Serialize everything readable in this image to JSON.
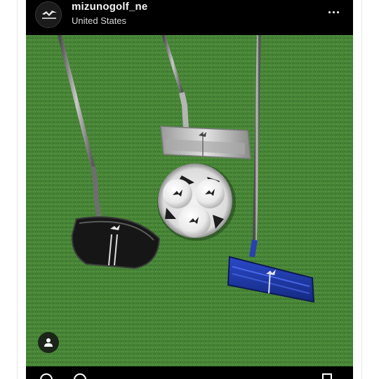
{
  "post": {
    "username": "mizunogolf_ne",
    "location": "United States",
    "avatar_icon": "mizuno-runbird-logo",
    "more_icon": "more-horizontal-icon",
    "tag_icon": "person-tag-icon"
  },
  "image": {
    "description_icon": "putters-and-golf-balls-photo"
  },
  "colors": {
    "header_bg": "#000000",
    "turf": "#4f8a3c",
    "username": "#f4f4f4"
  }
}
